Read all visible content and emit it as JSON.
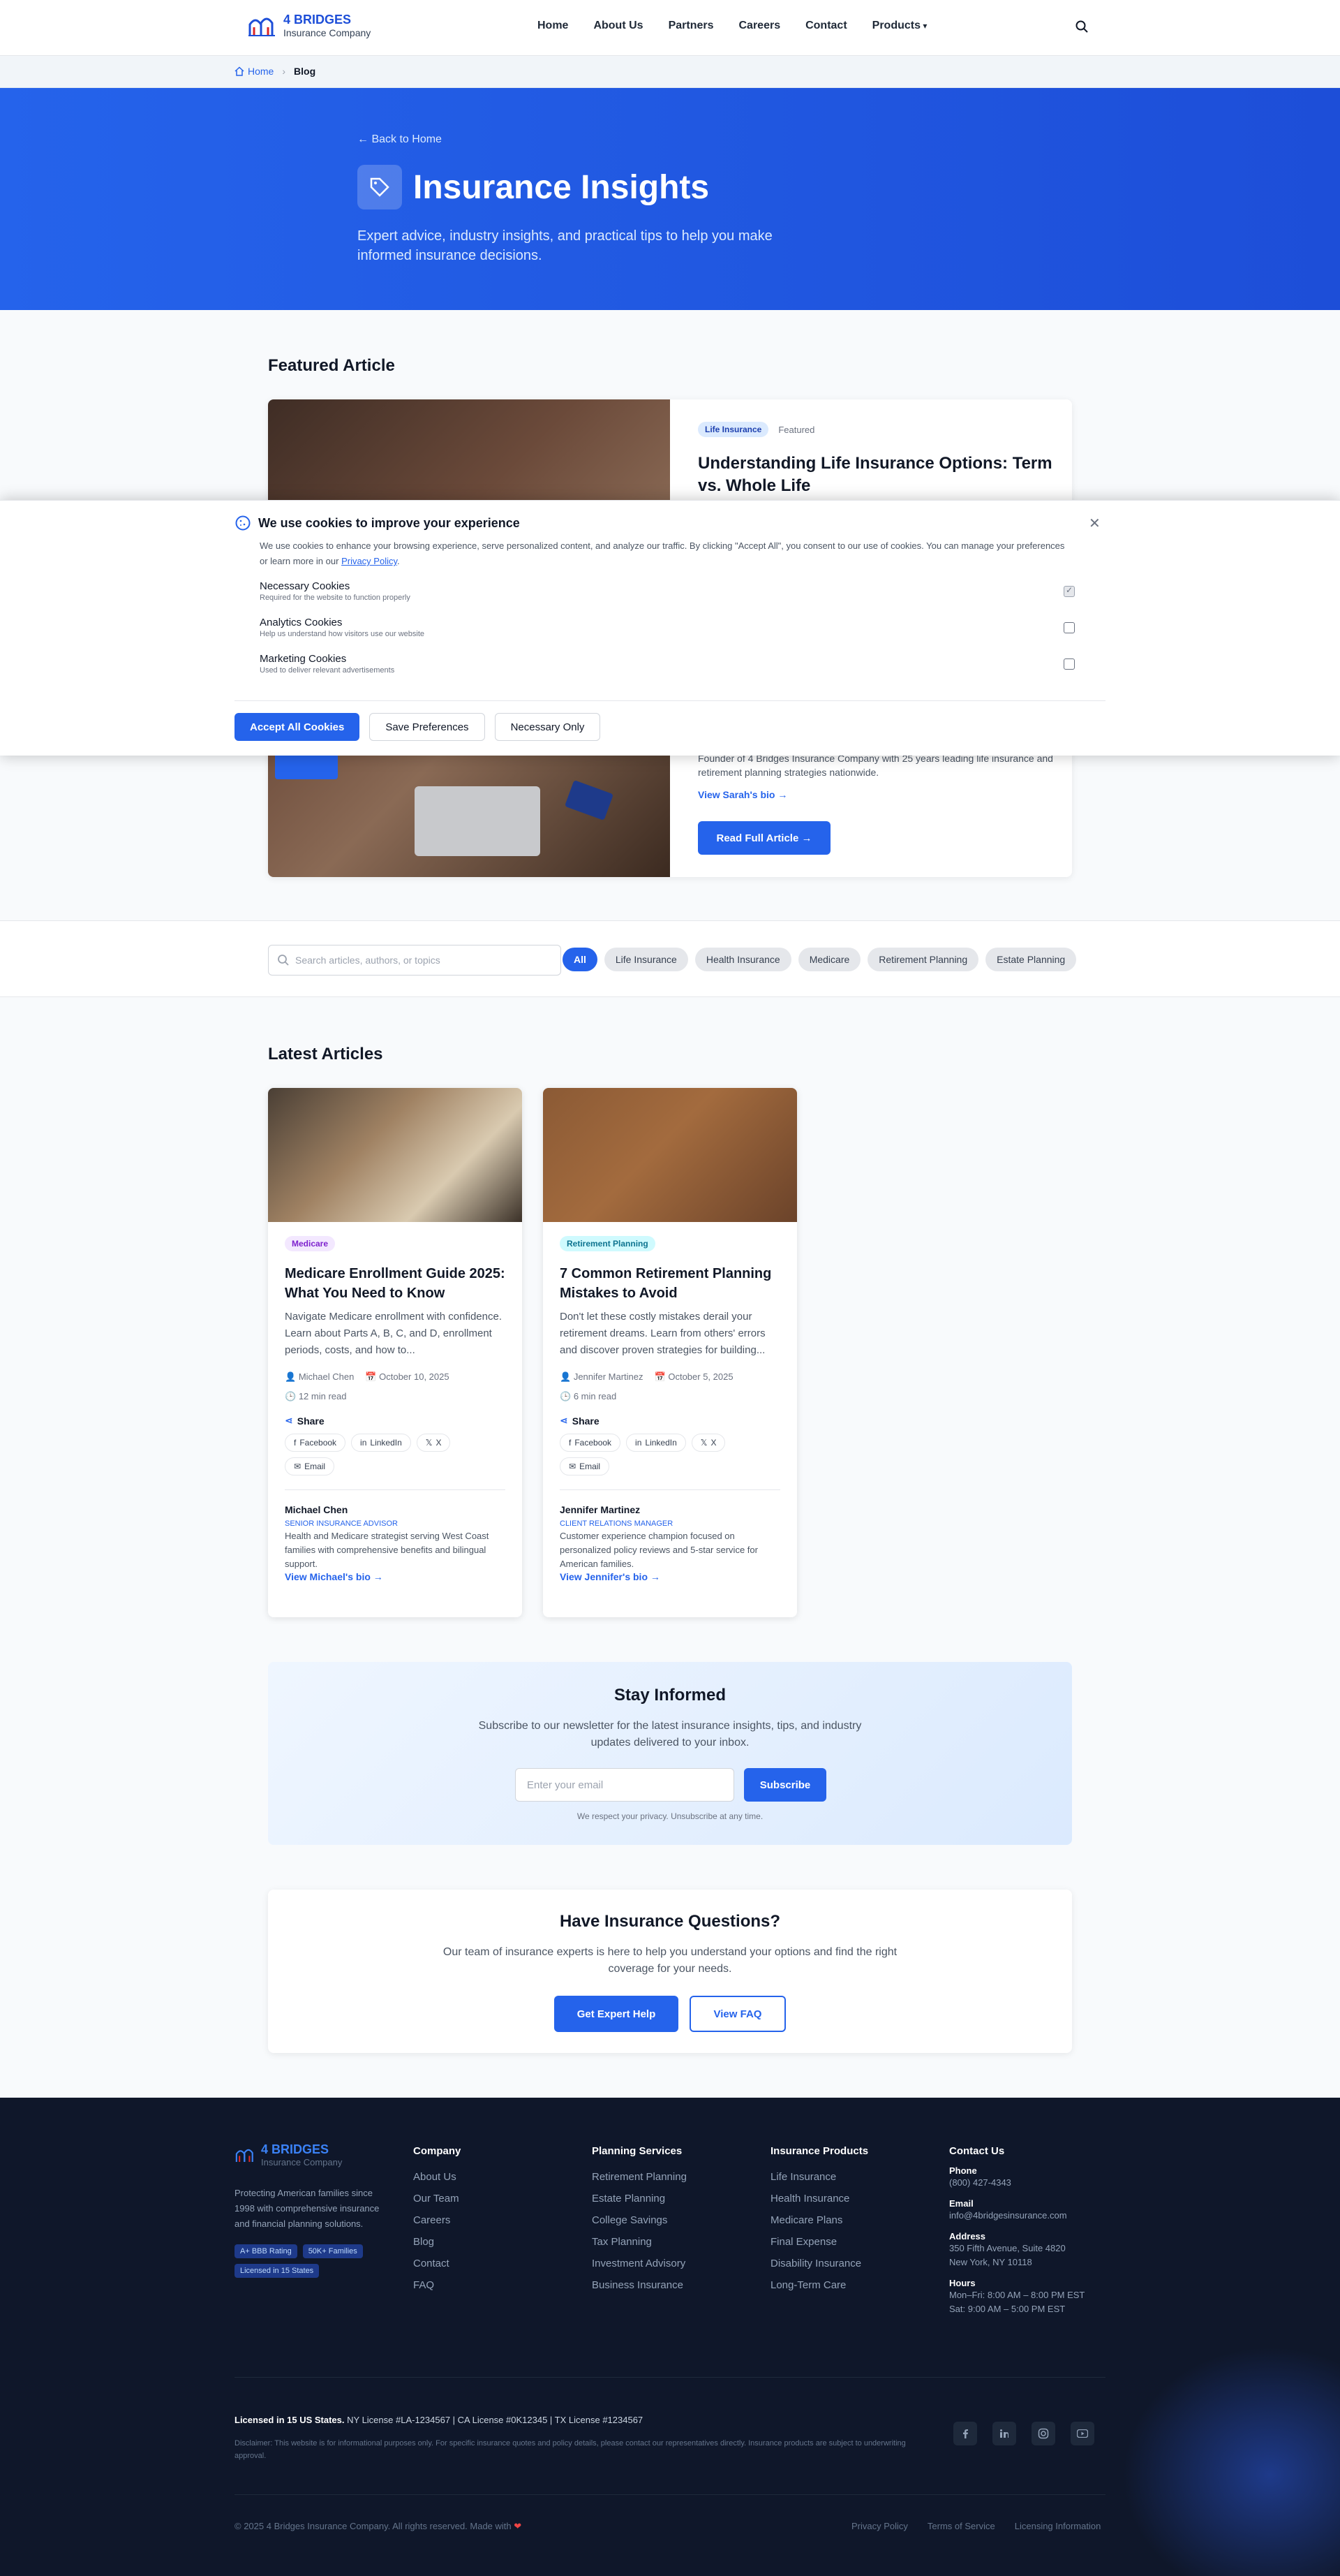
{
  "header": {
    "logo_line1": "4 BRIDGES",
    "logo_line2": "Insurance Company",
    "nav": [
      "Home",
      "About Us",
      "Partners",
      "Careers",
      "Contact",
      "Products"
    ]
  },
  "breadcrumb": {
    "home": "Home",
    "current": "Blog"
  },
  "hero": {
    "back": "Back to Home",
    "title": "Insurance Insights",
    "subtitle": "Expert advice, industry insights, and practical tips to help you make informed insurance decisions."
  },
  "featured": {
    "section_title": "Featured Article",
    "category": "Life Insurance",
    "flag": "Featured",
    "title": "Understanding Life Insurance Options: Term vs. Whole Life",
    "author_bio": "Founder of 4 Bridges Insurance Company with 25 years leading life insurance and retirement planning strategies nationwide.",
    "bio_link": "View Sarah's bio",
    "read_button": "Read Full Article"
  },
  "cookie": {
    "title": "We use cookies to improve your experience",
    "text_pre": "We use cookies to enhance your browsing experience, serve personalized content, and analyze our traffic. By clicking \"Accept All\", you consent to our use of cookies. You can manage your preferences or learn more in our ",
    "privacy_link": "Privacy Policy",
    "text_post": ".",
    "options": [
      {
        "name": "Necessary Cookies",
        "desc": "Required for the website to function properly",
        "checked": true,
        "disabled": true
      },
      {
        "name": "Analytics Cookies",
        "desc": "Help us understand how visitors use our website",
        "checked": false,
        "disabled": false
      },
      {
        "name": "Marketing Cookies",
        "desc": "Used to deliver relevant advertisements",
        "checked": false,
        "disabled": false
      }
    ],
    "accept": "Accept All Cookies",
    "save": "Save Preferences",
    "necessary": "Necessary Only"
  },
  "filters": {
    "search_placeholder": "Search articles, authors, or topics",
    "chips": [
      "All",
      "Life Insurance",
      "Health Insurance",
      "Medicare",
      "Retirement Planning",
      "Estate Planning"
    ],
    "active": "All"
  },
  "latest": {
    "section_title": "Latest Articles",
    "share_label": "Share",
    "share_buttons": [
      "Facebook",
      "LinkedIn",
      "X",
      "Email"
    ],
    "articles": [
      {
        "category": "Medicare",
        "title": "Medicare Enrollment Guide 2025: What You Need to Know",
        "excerpt": "Navigate Medicare enrollment with confidence. Learn about Parts A, B, C, and D, enrollment periods, costs, and how to...",
        "author": "Michael Chen",
        "date": "October 10, 2025",
        "read_time": "12 min read",
        "author_role": "Senior Insurance Advisor",
        "author_bio": "Health and Medicare strategist serving West Coast families with comprehensive benefits and bilingual support.",
        "bio_link": "View Michael's bio"
      },
      {
        "category": "Retirement Planning",
        "title": "7 Common Retirement Planning Mistakes to Avoid",
        "excerpt": "Don't let these costly mistakes derail your retirement dreams. Learn from others' errors and discover proven strategies for building...",
        "author": "Jennifer Martinez",
        "date": "October 5, 2025",
        "read_time": "6 min read",
        "author_role": "Client Relations Manager",
        "author_bio": "Customer experience champion focused on personalized policy reviews and 5-star service for American families.",
        "bio_link": "View Jennifer's bio"
      }
    ]
  },
  "newsletter": {
    "title": "Stay Informed",
    "text": "Subscribe to our newsletter for the latest insurance insights, tips, and industry updates delivered to your inbox.",
    "placeholder": "Enter your email",
    "button": "Subscribe",
    "note": "We respect your privacy. Unsubscribe at any time."
  },
  "cta": {
    "title": "Have Insurance Questions?",
    "text": "Our team of insurance experts is here to help you understand your options and find the right coverage for your needs.",
    "primary": "Get Expert Help",
    "secondary": "View FAQ"
  },
  "footer": {
    "logo_line1": "4 BRIDGES",
    "logo_line2": "Insurance Company",
    "desc": "Protecting American families since 1998 with comprehensive insurance and financial planning solutions.",
    "badges": [
      "A+ BBB Rating",
      "50K+ Families",
      "Licensed in 15 States"
    ],
    "columns": [
      {
        "title": "Company",
        "links": [
          "About Us",
          "Our Team",
          "Careers",
          "Blog",
          "Contact",
          "FAQ"
        ]
      },
      {
        "title": "Planning Services",
        "links": [
          "Retirement Planning",
          "Estate Planning",
          "College Savings",
          "Tax Planning",
          "Investment Advisory",
          "Business Insurance"
        ]
      },
      {
        "title": "Insurance Products",
        "links": [
          "Life Insurance",
          "Health Insurance",
          "Medicare Plans",
          "Final Expense",
          "Disability Insurance",
          "Long-Term Care"
        ]
      }
    ],
    "contact": {
      "title": "Contact Us",
      "phone_label": "Phone",
      "phone": "(800) 427-4343",
      "email_label": "Email",
      "email": "info@4bridgesinsurance.com",
      "address_label": "Address",
      "address1": "350 Fifth Avenue, Suite 4820",
      "address2": "New York, NY 10118",
      "hours_label": "Hours",
      "hours1": "Mon–Fri: 8:00 AM – 8:00 PM EST",
      "hours2": "Sat: 9:00 AM – 5:00 PM EST"
    },
    "license_bold": "Licensed in 15 US States.",
    "license_text": " NY License #LA-1234567 | CA License #0K12345 | TX License #1234567",
    "disclaimer": "Disclaimer: This website is for informational purposes only. For specific insurance quotes and policy details, please contact our representatives directly. Insurance products are subject to underwriting approval.",
    "copyright": "© 2025 4 Bridges Insurance Company. All rights reserved. Made with",
    "legal": [
      "Privacy Policy",
      "Terms of Service",
      "Licensing Information"
    ]
  }
}
